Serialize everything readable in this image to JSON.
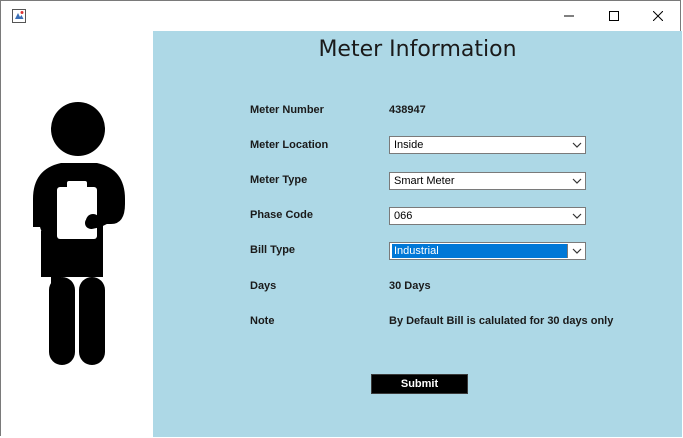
{
  "window": {
    "controls": {
      "minimize_icon": "minimize-icon",
      "maximize_icon": "maximize-icon",
      "close_icon": "close-icon"
    }
  },
  "form": {
    "title": "Meter Information",
    "meter_number": {
      "label": "Meter Number",
      "value": "438947"
    },
    "meter_location": {
      "label": "Meter Location",
      "selected": "Inside"
    },
    "meter_type": {
      "label": "Meter Type",
      "selected": "Smart Meter"
    },
    "phase_code": {
      "label": "Phase Code",
      "selected": "066"
    },
    "bill_type": {
      "label": "Bill Type",
      "selected": "Industrial"
    },
    "days": {
      "label": "Days",
      "value": "30 Days"
    },
    "note": {
      "label": "Note",
      "value": "By Default Bill is calulated for 30 days only"
    },
    "submit_label": "Submit"
  },
  "colors": {
    "panel_bg": "#add8e6",
    "selection": "#0078d7",
    "button_bg": "#000000"
  },
  "illustration": "person-with-clipboard-icon"
}
